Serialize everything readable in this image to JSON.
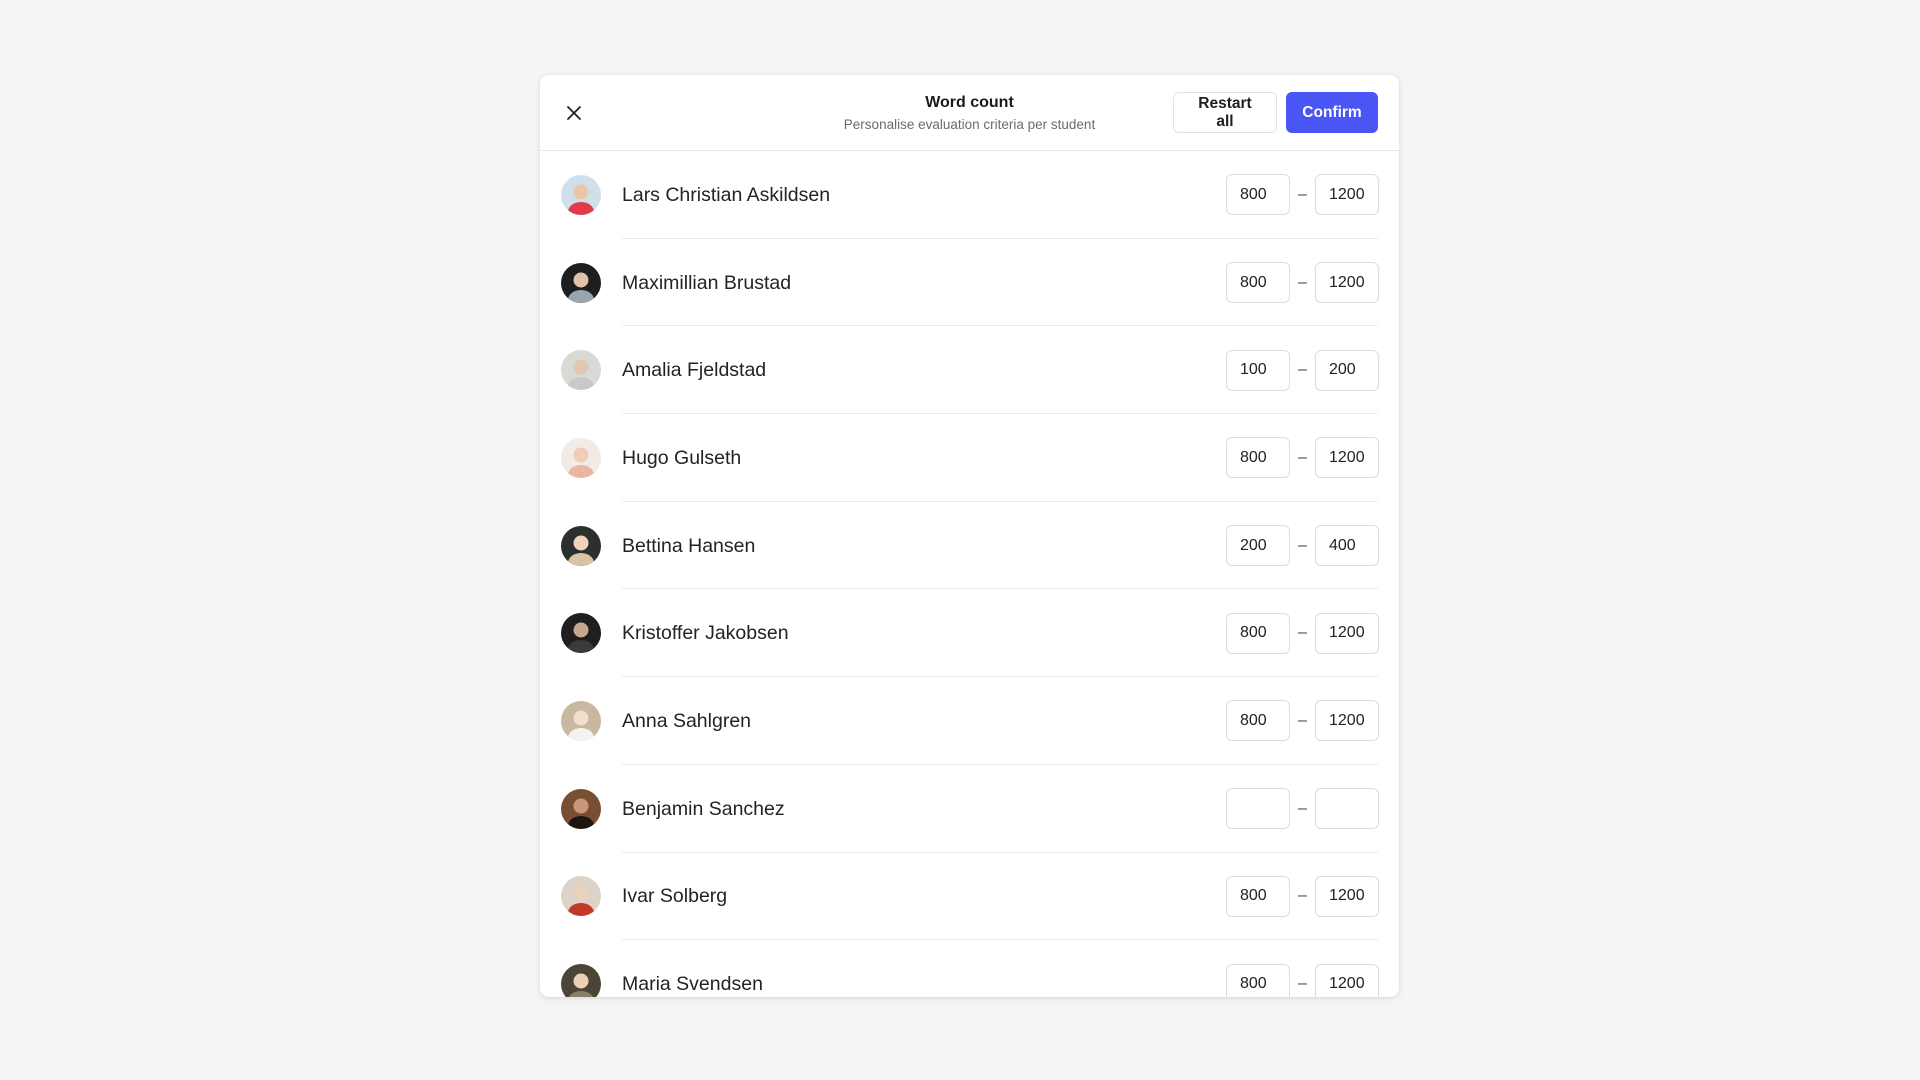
{
  "dialog": {
    "title": "Word count",
    "subtitle": "Personalise evaluation criteria per student",
    "close_icon": "close-icon",
    "restart_label": "Restart all",
    "confirm_label": "Confirm",
    "accent_color": "#4a55f5"
  },
  "range_separator": "–",
  "students": [
    {
      "name": "Lars Christian Askildsen",
      "min": "800",
      "max": "1200",
      "avatar": {
        "bg": "#cfe0ea",
        "fg": "#e23a4a",
        "skin": "#e8c7a8"
      }
    },
    {
      "name": "Maximillian Brustad",
      "min": "800",
      "max": "1200",
      "avatar": {
        "bg": "#1e1e1e",
        "fg": "#9aa4ad",
        "skin": "#e0c2a6"
      }
    },
    {
      "name": "Amalia Fjeldstad",
      "min": "100",
      "max": "200",
      "avatar": {
        "bg": "#d9d9d6",
        "fg": "#c9c9c9",
        "skin": "#e2c6ad"
      }
    },
    {
      "name": "Hugo Gulseth",
      "min": "800",
      "max": "1200",
      "avatar": {
        "bg": "#f1ebe6",
        "fg": "#e9b7a0",
        "skin": "#f0cdb6"
      }
    },
    {
      "name": "Bettina Hansen",
      "min": "200",
      "max": "400",
      "avatar": {
        "bg": "#2c2f2c",
        "fg": "#d9c2a5",
        "skin": "#f1d3bd"
      }
    },
    {
      "name": "Kristoffer Jakobsen",
      "min": "800",
      "max": "1200",
      "avatar": {
        "bg": "#1f1f1f",
        "fg": "#3a3a3a",
        "skin": "#c9a58c"
      }
    },
    {
      "name": "Anna Sahlgren",
      "min": "800",
      "max": "1200",
      "avatar": {
        "bg": "#c9b89f",
        "fg": "#f2f2f2",
        "skin": "#f2dccb"
      }
    },
    {
      "name": "Benjamin Sanchez",
      "min": "",
      "max": "",
      "avatar": {
        "bg": "#7a4e33",
        "fg": "#1d1512",
        "skin": "#c99779"
      }
    },
    {
      "name": "Ivar Solberg",
      "min": "800",
      "max": "1200",
      "avatar": {
        "bg": "#ddd3c8",
        "fg": "#c0392b",
        "skin": "#ecd1bd"
      }
    },
    {
      "name": "Maria Svendsen",
      "min": "800",
      "max": "1200",
      "avatar": {
        "bg": "#4b4538",
        "fg": "#8c7f6a",
        "skin": "#efcfb6"
      }
    }
  ]
}
